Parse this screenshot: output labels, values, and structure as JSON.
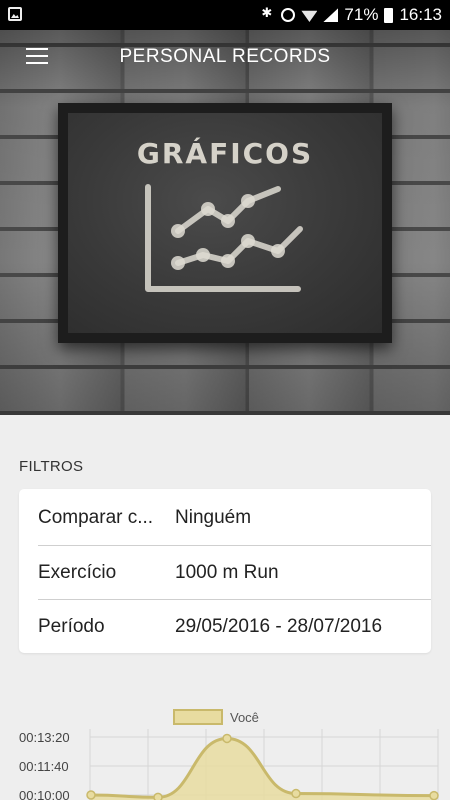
{
  "status_bar": {
    "battery": "71%",
    "time": "16:13",
    "icons": [
      "image-icon",
      "bluetooth-icon",
      "alarm-icon",
      "wifi-icon",
      "signal-icon",
      "battery-icon"
    ]
  },
  "app_bar": {
    "title": "PERSONAL RECORDS",
    "menu_icon": "hamburger-menu-icon"
  },
  "hero": {
    "board_title": "GRÁFICOS"
  },
  "filters": {
    "heading": "FILTROS",
    "rows": [
      {
        "label": "Comparar c...",
        "value": "Ninguém"
      },
      {
        "label": "Exercício",
        "value": "1000 m Run"
      },
      {
        "label": "Período",
        "value": "29/05/2016 - 28/07/2016"
      }
    ]
  },
  "chart_data": {
    "type": "area",
    "series": [
      {
        "name": "Você",
        "color": "#c9b96b",
        "fill": "#e8dca0",
        "values_seconds": [
          600,
          592,
          795,
          605,
          598
        ]
      }
    ],
    "y_tick_labels": [
      "00:13:20",
      "00:11:40",
      "00:10:00"
    ],
    "y_ticks_seconds": [
      800,
      700,
      600
    ],
    "ylim_seconds": [
      600,
      800
    ],
    "grid": true,
    "legend_placement": "top-center"
  }
}
